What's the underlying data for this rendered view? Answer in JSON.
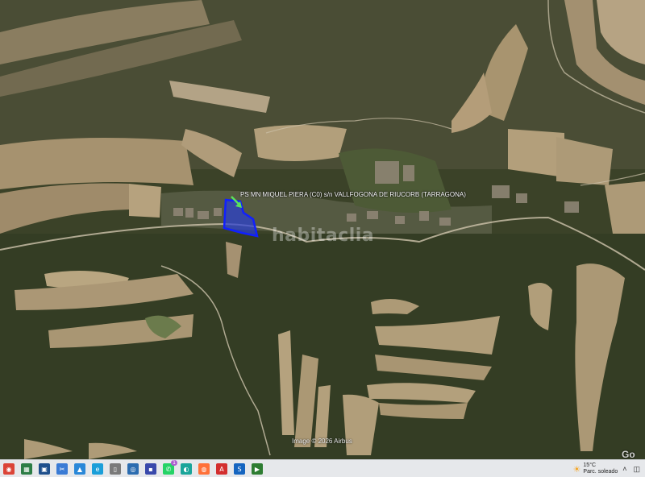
{
  "map": {
    "parcel_label": "PS MN MIQUEL PIERA (C0) s/n VALLFOGONA DE RIUCORB (TARRAGONA)",
    "watermark": "habitaclia",
    "imagery_credit": "Image © 2026 Airbus",
    "logo_fragment": "Go",
    "colors": {
      "parcel_fill": "#2a3fd6",
      "parcel_stroke": "#1020ff",
      "arrow": "#5be35b",
      "forest": "#3a4226",
      "field": "#a89474"
    }
  },
  "taskbar": {
    "apps": [
      {
        "name": "chrome",
        "glyph": "◉",
        "color": "#db4437"
      },
      {
        "name": "calendar",
        "glyph": "▦",
        "color": "#2d7d46"
      },
      {
        "name": "screenshot",
        "glyph": "▣",
        "color": "#1e4f8c"
      },
      {
        "name": "snipping",
        "glyph": "✂",
        "color": "#3a7bd5"
      },
      {
        "name": "photos",
        "glyph": "▲",
        "color": "#2a88d8"
      },
      {
        "name": "edge",
        "glyph": "e",
        "color": "#1b9fd9"
      },
      {
        "name": "file",
        "glyph": "▯",
        "color": "#7a7a7a"
      },
      {
        "name": "app-blue",
        "glyph": "◎",
        "color": "#2b6cb0"
      },
      {
        "name": "save",
        "glyph": "▪",
        "color": "#3949ab"
      },
      {
        "name": "whatsapp",
        "glyph": "✆",
        "color": "#25d366"
      },
      {
        "name": "copilot",
        "glyph": "◐",
        "color": "#1aa59a"
      },
      {
        "name": "firefox",
        "glyph": "◍",
        "color": "#ff7139"
      },
      {
        "name": "acrobat",
        "glyph": "A",
        "color": "#d32f2f"
      },
      {
        "name": "app-s",
        "glyph": "S",
        "color": "#1565c0"
      },
      {
        "name": "app-green",
        "glyph": "▶",
        "color": "#2e7d32"
      }
    ],
    "badge_count": "1",
    "weather": {
      "temp": "15°C",
      "condition": "Parc. soleado"
    }
  }
}
